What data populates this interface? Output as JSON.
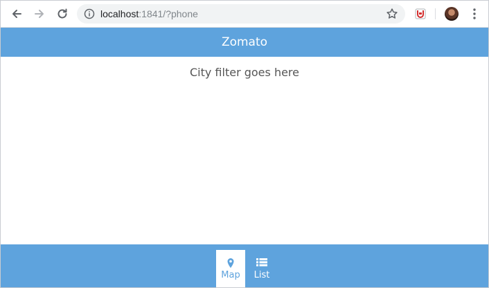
{
  "browser": {
    "url_host": "localhost",
    "url_path": ":1841/?phone"
  },
  "app": {
    "title": "Zomato",
    "content_text": "City filter goes here"
  },
  "tabs": [
    {
      "label": "Map",
      "icon": "map-marker-icon",
      "active": true
    },
    {
      "label": "List",
      "icon": "list-icon",
      "active": false
    }
  ],
  "colors": {
    "accent": "#5ea3dd",
    "content_text": "#555555"
  }
}
